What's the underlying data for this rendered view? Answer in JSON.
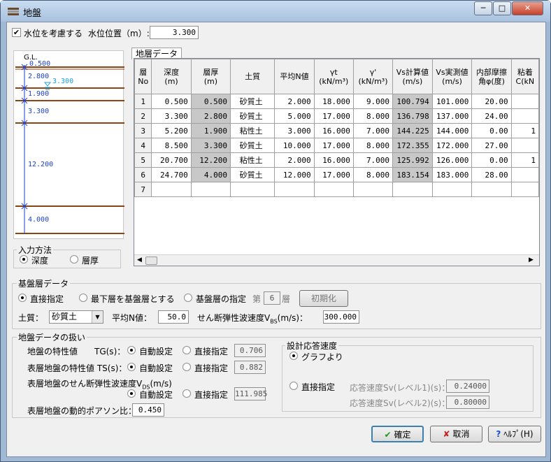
{
  "window": {
    "title": "地盤",
    "min": "─",
    "max": "□",
    "close": "✕"
  },
  "water": {
    "consider_label": "水位を考慮する",
    "position_label": "水位位置（m）:",
    "position_value": "3.300"
  },
  "diagram": {
    "gl_label": "G.L.",
    "top_value": "0.500",
    "water_label": "3.300",
    "thickness_labels": [
      "2.800",
      "1.900",
      "3.300",
      "12.200",
      "4.000"
    ]
  },
  "input_method": {
    "title": "入力方法",
    "depth": "深度",
    "thickness": "層厚"
  },
  "tab": {
    "label": "地層データ"
  },
  "table": {
    "headers": [
      "層\nNo",
      "深度\n(m)",
      "層厚\n(m)",
      "土質",
      "平均N値",
      "γt\n(kN/m³)",
      "γ'\n(kN/m³)",
      "Vs計算値\n(m/s)",
      "Vs実測値\n(m/s)",
      "内部摩擦\n角φ(度)",
      "粘着\nC(kN"
    ],
    "rows": [
      [
        "1",
        "0.500",
        "0.500",
        "砂質土",
        "2.000",
        "18.000",
        "9.000",
        "100.794",
        "101.000",
        "20.00",
        ""
      ],
      [
        "2",
        "3.300",
        "2.800",
        "砂質土",
        "5.000",
        "17.000",
        "8.000",
        "136.798",
        "137.000",
        "24.00",
        ""
      ],
      [
        "3",
        "5.200",
        "1.900",
        "粘性土",
        "3.000",
        "16.000",
        "7.000",
        "144.225",
        "144.000",
        "0.00",
        "1"
      ],
      [
        "4",
        "8.500",
        "3.300",
        "砂質土",
        "10.000",
        "17.000",
        "8.000",
        "172.355",
        "172.000",
        "27.00",
        ""
      ],
      [
        "5",
        "20.700",
        "12.200",
        "粘性土",
        "2.000",
        "16.000",
        "7.000",
        "125.992",
        "126.000",
        "0.00",
        "1"
      ],
      [
        "6",
        "24.700",
        "4.000",
        "砂質土",
        "12.000",
        "17.000",
        "8.000",
        "183.154",
        "183.000",
        "28.00",
        ""
      ],
      [
        "7",
        "",
        "",
        "",
        "",
        "",
        "",
        "",
        "",
        "",
        ""
      ]
    ]
  },
  "base": {
    "title": "基盤層データ",
    "direct": "直接指定",
    "lowest": "最下層を基盤層とする",
    "specify": "基盤層の指定",
    "layer_prefix": "第",
    "layer_value": "6",
    "layer_suffix": "層",
    "init_button": "初期化",
    "soil_label": "土質：",
    "soil_value": "砂質土",
    "n_label": "平均N値：",
    "n_value": "50.0",
    "vbs_label": "せん断弾性波速度V",
    "vbs_sub": "BS",
    "vbs_unit": "(m/s)：",
    "vbs_value": "300.000"
  },
  "handling": {
    "title": "地盤データの扱い",
    "tg_label": "地盤の特性値　　TG(s)：",
    "ts_label": "表層地盤の特性値 TS(s)：",
    "vds_label": "表層地盤のせん断弾性波速度V",
    "vds_sub": "DS",
    "vds_unit": "(m/s)",
    "auto": "自動設定",
    "direct": "直接指定",
    "tg_value": "0.706",
    "ts_value": "0.882",
    "vds_value": "111.985",
    "poisson_label": "表層地盤の動的ポアソン比：",
    "poisson_value": "0.450"
  },
  "response": {
    "title": "設計応答速度",
    "graph": "グラフより",
    "direct": "直接指定",
    "sv1_label": "応答速度Sv(レベル1)(s)：",
    "sv1_value": "0.24000",
    "sv2_label": "応答速度Sv(レベル2)(s)：",
    "sv2_value": "0.80000"
  },
  "buttons": {
    "ok": "確定",
    "cancel": "取消",
    "help": "ﾍﾙﾌﾟ(H)"
  },
  "colors": {
    "layer_line": "#8b4513",
    "dim_line": "#1a3fcc",
    "water": "#1aa0e0",
    "shaded": "#c8c8c8"
  }
}
